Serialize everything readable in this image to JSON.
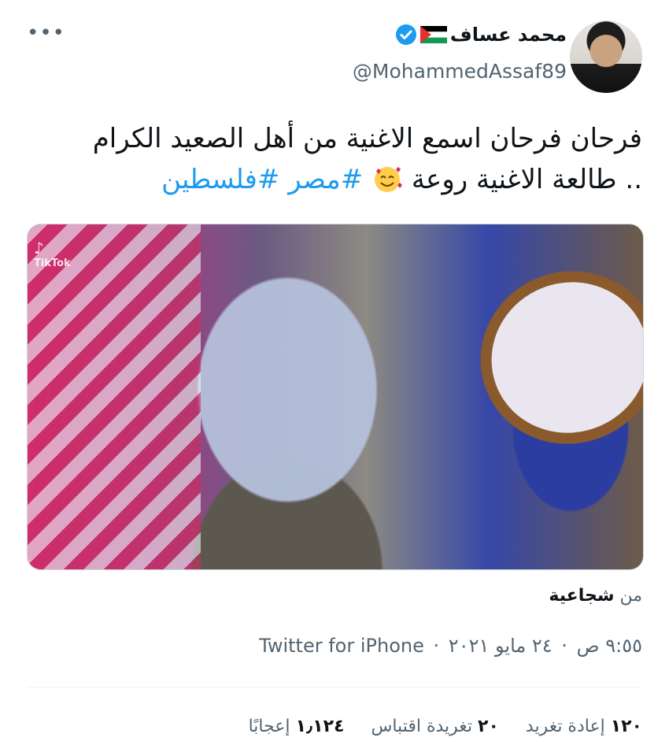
{
  "header": {
    "display_name": "محمد عساف",
    "handle": "@MohammedAssaf89",
    "more_icon": "more-dots-icon",
    "verified_icon": "verified-badge-icon",
    "flag_icon": "palestine-flag-icon"
  },
  "tweet": {
    "line1": "فرحان فرحان اسمع الاغنية من أهل الصعيد الكرام",
    "line2_prefix": ".. طالعة الاغنية روعة",
    "emoji": "smiling-face-with-hearts-icon",
    "hashtags": [
      "#مصر",
      "#فلسطين"
    ]
  },
  "media": {
    "watermark": "TikTok"
  },
  "location": {
    "prefix": "من",
    "place": "شجاعية"
  },
  "meta": {
    "time": "٩:٥٥ ص",
    "separator": "·",
    "date": "٢٤ مايو ٢٠٢١",
    "source": "Twitter for iPhone"
  },
  "stats": {
    "retweets_num": "١٢٠",
    "retweets_label": "إعادة تغريد",
    "quotes_num": "٢٠",
    "quotes_label": "تغريدة اقتباس",
    "likes_num": "١٫١٢٤",
    "likes_label": "إعجابًا"
  },
  "colors": {
    "accent": "#1d9bf0",
    "text": "#0f1419",
    "muted": "#536471"
  }
}
